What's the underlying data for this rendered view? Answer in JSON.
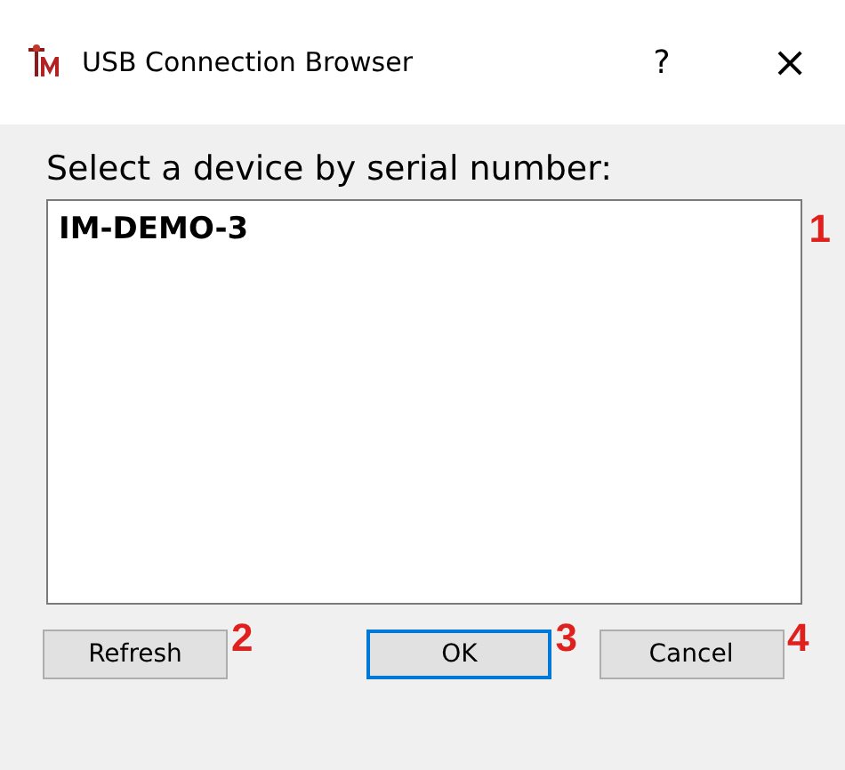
{
  "window": {
    "title": "USB Connection Browser",
    "help": "?",
    "close": "×"
  },
  "prompt": "Select a device by serial number:",
  "devices": [
    {
      "label": "IM-DEMO-3",
      "selected": false
    }
  ],
  "buttons": [
    {
      "label": "Refresh",
      "kind": "left",
      "focused": false,
      "callout": "2"
    },
    {
      "label": "OK",
      "kind": "right",
      "focused": true,
      "callout": "3"
    },
    {
      "label": "Cancel",
      "kind": "right",
      "focused": false,
      "callout": "4"
    }
  ],
  "list_callout": "1"
}
